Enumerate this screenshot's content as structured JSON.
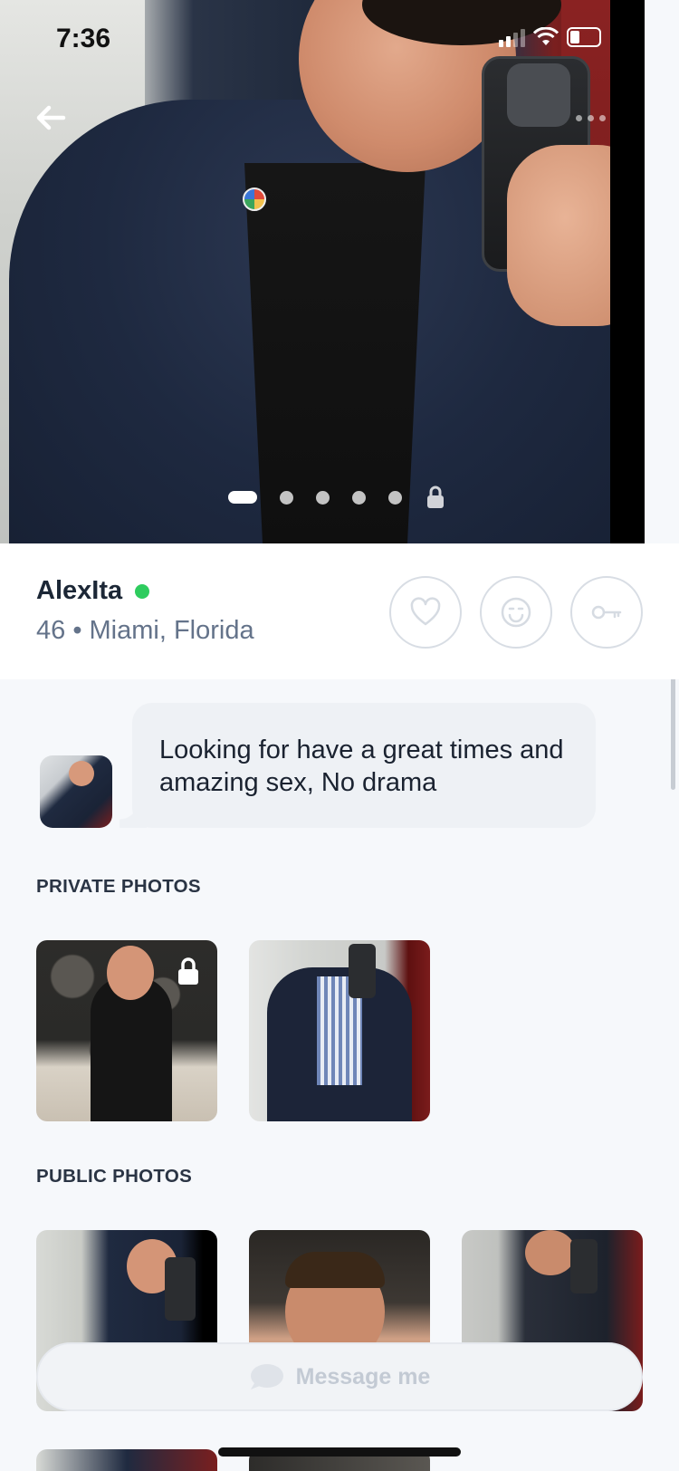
{
  "status_bar": {
    "time": "7:36"
  },
  "hero": {
    "photo_count": 5,
    "active_index": 0,
    "has_locked_photo": true
  },
  "profile": {
    "name": "AlexIta",
    "meta": "46 • Miami, Florida",
    "online": true,
    "online_color": "#2ecc5e"
  },
  "actions": [
    {
      "name": "like",
      "icon": "heart-icon"
    },
    {
      "name": "wink",
      "icon": "smile-icon"
    },
    {
      "name": "request-access",
      "icon": "key-icon"
    }
  ],
  "bio": {
    "text": "Looking for have a great times and amazing sex, No drama"
  },
  "sections": {
    "private_title": "PRIVATE PHOTOS",
    "public_title": "PUBLIC PHOTOS"
  },
  "message_bar": {
    "label": "Message me"
  }
}
